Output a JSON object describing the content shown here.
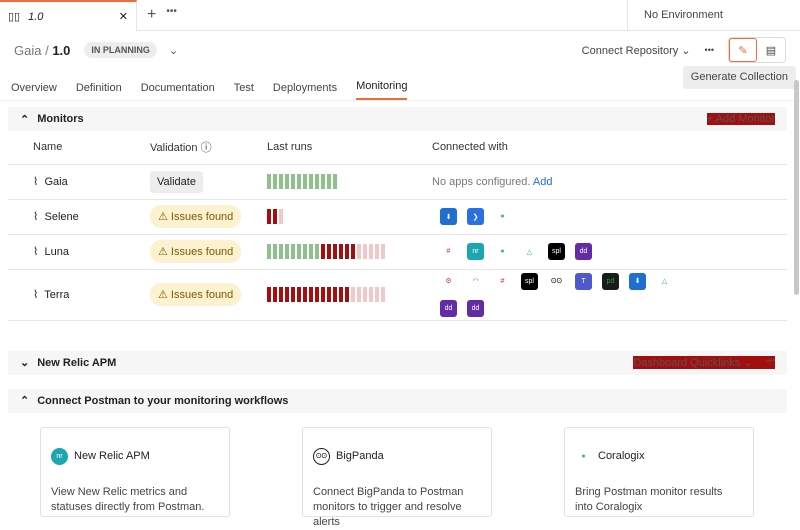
{
  "tab": {
    "title": "1.0",
    "env": "No Environment"
  },
  "header": {
    "project": "Gaia",
    "version": "1.0",
    "status": "IN PLANNING",
    "connect": "Connect Repository"
  },
  "nav": {
    "tabs": [
      "Overview",
      "Definition",
      "Documentation",
      "Test",
      "Deployments",
      "Monitoring"
    ],
    "generate": "Generate Collection"
  },
  "monitors": {
    "title": "Monitors",
    "add": "+ Add Monitor",
    "cols": [
      "Name",
      "Validation",
      "Last runs",
      "Connected with"
    ],
    "rows": [
      {
        "name": "Gaia",
        "validation": "Validate",
        "runs": "gggggggggggg",
        "apps": [],
        "empty": "No apps configured.",
        "add": "Add"
      },
      {
        "name": "Selene",
        "validation": "Issues found",
        "runs": "rrp",
        "apps": [
          "opsgenie",
          "power-automate",
          "coralogix"
        ]
      },
      {
        "name": "Luna",
        "validation": "Issues found",
        "runs": "gggggggggrrrrrrppppp",
        "apps": [
          "slack",
          "new-relic",
          "coralogix",
          "lightstep",
          "splunk",
          "datadog"
        ]
      },
      {
        "name": "Terra",
        "validation": "Issues found",
        "runs": "rrrrrrrrrrrrrrpppppp",
        "apps": [
          "webhook",
          "statuspage",
          "slack",
          "splunk",
          "bigpanda",
          "teams",
          "pagerduty",
          "opsgenie",
          "lightstep",
          "datadog",
          "datadog"
        ]
      }
    ]
  },
  "newrelic": {
    "title": "New Relic APM",
    "quick": "Dashboard Quicklinks"
  },
  "connect": {
    "title": "Connect Postman to your monitoring workflows",
    "cards": [
      {
        "name": "New Relic APM",
        "desc": "View New Relic metrics and statuses directly from Postman."
      },
      {
        "name": "BigPanda",
        "desc": "Connect BigPanda to Postman monitors to trigger and resolve alerts"
      },
      {
        "name": "Coralogix",
        "desc": "Bring Postman monitor results into Coralogix"
      }
    ]
  },
  "colors": {
    "accent": "#f26b3a",
    "pass": "#8fc18f",
    "fail": "#a50e0e",
    "pending": "#f3c7c7",
    "link": "#1f6fd1"
  }
}
